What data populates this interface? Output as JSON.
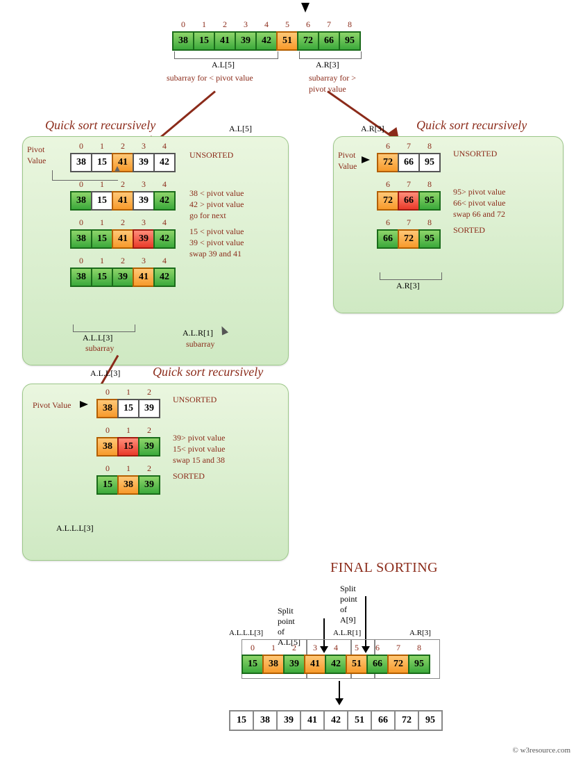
{
  "top": {
    "indices": [
      "0",
      "1",
      "2",
      "3",
      "4",
      "5",
      "6",
      "7",
      "8"
    ],
    "cells": [
      {
        "v": "38",
        "c": "green"
      },
      {
        "v": "15",
        "c": "green"
      },
      {
        "v": "41",
        "c": "green"
      },
      {
        "v": "39",
        "c": "green"
      },
      {
        "v": "42",
        "c": "green"
      },
      {
        "v": "51",
        "c": "orange"
      },
      {
        "v": "72",
        "c": "green"
      },
      {
        "v": "66",
        "c": "green"
      },
      {
        "v": "95",
        "c": "green"
      }
    ],
    "left_bracket": "A.L[5]",
    "right_bracket": "A.R[3]",
    "left_note": "subarray for < pivot value",
    "right_note": "subarray for > pivot value"
  },
  "panelL": {
    "title": "Quick sort recursively",
    "header_lbl": "A.L[5]",
    "pivot_lbl": "Pivot\nValue",
    "rows": [
      {
        "idx": [
          "0",
          "1",
          "2",
          "3",
          "4"
        ],
        "cells": [
          {
            "v": "38",
            "c": "white"
          },
          {
            "v": "15",
            "c": "white"
          },
          {
            "v": "41",
            "c": "orange"
          },
          {
            "v": "39",
            "c": "white"
          },
          {
            "v": "42",
            "c": "white"
          }
        ],
        "side": "UNSORTED"
      },
      {
        "idx": [
          "0",
          "1",
          "2",
          "3",
          "4"
        ],
        "cells": [
          {
            "v": "38",
            "c": "green"
          },
          {
            "v": "15",
            "c": "white"
          },
          {
            "v": "41",
            "c": "orange"
          },
          {
            "v": "39",
            "c": "white"
          },
          {
            "v": "42",
            "c": "green"
          }
        ],
        "side": "38 < pivot value\n42 > pivot value\ngo for next"
      },
      {
        "idx": [
          "0",
          "1",
          "2",
          "3",
          "4"
        ],
        "cells": [
          {
            "v": "38",
            "c": "green"
          },
          {
            "v": "15",
            "c": "green"
          },
          {
            "v": "41",
            "c": "orange"
          },
          {
            "v": "39",
            "c": "red"
          },
          {
            "v": "42",
            "c": "green"
          }
        ],
        "side": "15 < pivot value\n39 < pivot value\nswap 39 and 41"
      },
      {
        "idx": [
          "0",
          "1",
          "2",
          "3",
          "4"
        ],
        "cells": [
          {
            "v": "38",
            "c": "green"
          },
          {
            "v": "15",
            "c": "green"
          },
          {
            "v": "39",
            "c": "green"
          },
          {
            "v": "41",
            "c": "orange"
          },
          {
            "v": "42",
            "c": "green"
          }
        ],
        "side": ""
      }
    ],
    "bottom_left": "A.L.L[3]",
    "bottom_left_sub": "subarray",
    "bottom_right": "A.L.R[1]",
    "bottom_right_sub": "subarray"
  },
  "panelR": {
    "title": "Quick sort recursively",
    "header_lbl": "A.R[3]",
    "pivot_lbl": "Pivot\nValue",
    "rows": [
      {
        "idx": [
          "6",
          "7",
          "8"
        ],
        "cells": [
          {
            "v": "72",
            "c": "orange"
          },
          {
            "v": "66",
            "c": "white"
          },
          {
            "v": "95",
            "c": "white"
          }
        ],
        "side": "UNSORTED"
      },
      {
        "idx": [
          "6",
          "7",
          "8"
        ],
        "cells": [
          {
            "v": "72",
            "c": "orange"
          },
          {
            "v": "66",
            "c": "red"
          },
          {
            "v": "95",
            "c": "green"
          }
        ],
        "side": "95> pivot value\n66< pivot value\nswap 66 and 72"
      },
      {
        "idx": [
          "6",
          "7",
          "8"
        ],
        "cells": [
          {
            "v": "66",
            "c": "green"
          },
          {
            "v": "72",
            "c": "orange"
          },
          {
            "v": "95",
            "c": "green"
          }
        ],
        "side": "SORTED"
      }
    ],
    "bottom": "A.R[3]"
  },
  "panelLL": {
    "header_lbl": "A.L.L[3]",
    "title": "Quick sort recursively",
    "pivot_lbl": "Pivot Value",
    "rows": [
      {
        "idx": [
          "0",
          "1",
          "2"
        ],
        "cells": [
          {
            "v": "38",
            "c": "orange"
          },
          {
            "v": "15",
            "c": "white"
          },
          {
            "v": "39",
            "c": "white"
          }
        ],
        "side": "UNSORTED"
      },
      {
        "idx": [
          "0",
          "1",
          "2"
        ],
        "cells": [
          {
            "v": "38",
            "c": "orange"
          },
          {
            "v": "15",
            "c": "red"
          },
          {
            "v": "39",
            "c": "green"
          }
        ],
        "side": "39> pivot value\n15< pivot value\nswap 15 and 38"
      },
      {
        "idx": [
          "0",
          "1",
          "2"
        ],
        "cells": [
          {
            "v": "15",
            "c": "green"
          },
          {
            "v": "38",
            "c": "orange"
          },
          {
            "v": "39",
            "c": "green"
          }
        ],
        "side": "SORTED"
      }
    ],
    "bottom": "A.L.L.L[3]"
  },
  "final": {
    "title": "FINAL SORTING",
    "split1": "Split point of A[9]",
    "split2": "Split point of A.L[5]",
    "grpL": "A.L.L.L[3]",
    "grpM": "A.L.R[1]",
    "grpR": "A.R[3]",
    "indices": [
      "0",
      "1",
      "2",
      "3",
      "4",
      "5",
      "6",
      "7",
      "8"
    ],
    "cells": [
      {
        "v": "15",
        "c": "green"
      },
      {
        "v": "38",
        "c": "orange"
      },
      {
        "v": "39",
        "c": "green"
      },
      {
        "v": "41",
        "c": "orange"
      },
      {
        "v": "42",
        "c": "green"
      },
      {
        "v": "51",
        "c": "orange"
      },
      {
        "v": "66",
        "c": "green"
      },
      {
        "v": "72",
        "c": "orange"
      },
      {
        "v": "95",
        "c": "green"
      }
    ],
    "result": [
      "15",
      "38",
      "39",
      "41",
      "42",
      "51",
      "66",
      "72",
      "95"
    ]
  },
  "footer": "© w3resource.com"
}
